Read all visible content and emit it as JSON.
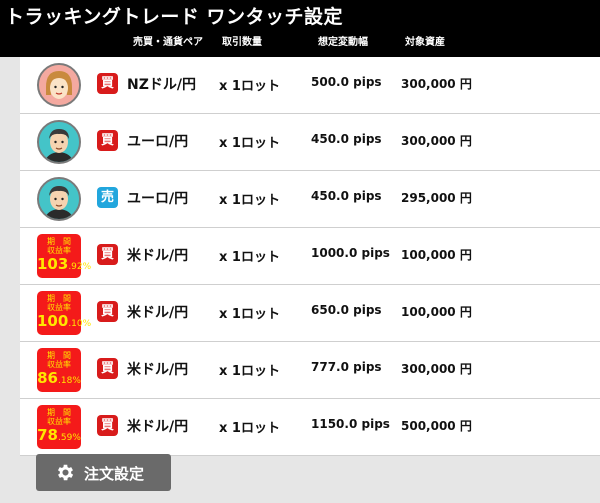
{
  "header": {
    "title": "トラッキングトレード ワンタッチ設定",
    "columns": {
      "pair": "売買・通貨ペア",
      "quantity": "取引数量",
      "fluctuation": "想定変動幅",
      "capital": "対象資産"
    }
  },
  "rows": [
    {
      "icon": "avatar-female-icon",
      "side": "買",
      "side_type": "buy",
      "pair": "NZドル/円",
      "qty": "x 1ロット",
      "pips": "500.0 pips",
      "amount": "300,000 円"
    },
    {
      "icon": "avatar-male-icon",
      "side": "買",
      "side_type": "buy",
      "pair": "ユーロ/円",
      "qty": "x 1ロット",
      "pips": "450.0 pips",
      "amount": "300,000 円"
    },
    {
      "icon": "avatar-male-icon",
      "side": "売",
      "side_type": "sell",
      "pair": "ユーロ/円",
      "qty": "x 1ロット",
      "pips": "450.0 pips",
      "amount": "295,000 円"
    },
    {
      "perf": {
        "line1": "期　間",
        "line2": "収益率",
        "int": "103",
        "dec": ".92%"
      },
      "side": "買",
      "side_type": "buy",
      "pair": "米ドル/円",
      "qty": "x 1ロット",
      "pips": "1000.0 pips",
      "amount": "100,000 円"
    },
    {
      "perf": {
        "line1": "期　間",
        "line2": "収益率",
        "int": "100",
        "dec": ".10%"
      },
      "side": "買",
      "side_type": "buy",
      "pair": "米ドル/円",
      "qty": "x 1ロット",
      "pips": "650.0 pips",
      "amount": "100,000 円"
    },
    {
      "perf": {
        "line1": "期　間",
        "line2": "収益率",
        "int": "86",
        "dec": ".18%"
      },
      "side": "買",
      "side_type": "buy",
      "pair": "米ドル/円",
      "qty": "x 1ロット",
      "pips": "777.0 pips",
      "amount": "300,000 円"
    },
    {
      "perf": {
        "line1": "期　間",
        "line2": "収益率",
        "int": "78",
        "dec": ".59%"
      },
      "side": "買",
      "side_type": "buy",
      "pair": "米ドル/円",
      "qty": "x 1ロット",
      "pips": "1150.0 pips",
      "amount": "500,000 円"
    }
  ],
  "footer": {
    "order_settings_label": "注文設定",
    "icon": "gear-icon"
  },
  "colors": {
    "buy": "#d81b1b",
    "sell": "#21a6dd",
    "perf_badge": "#f41a1a",
    "header_bg": "#000000"
  }
}
